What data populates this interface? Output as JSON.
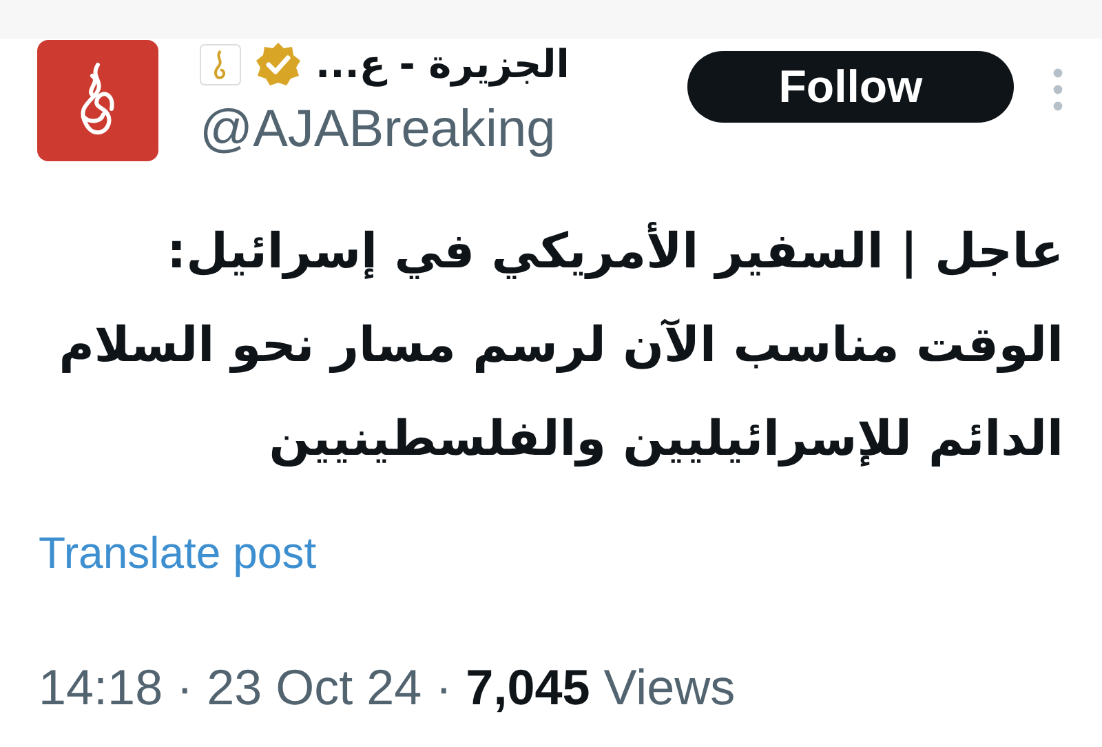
{
  "author": {
    "name": "الجزيرة - ع...",
    "verified": true,
    "handle": "@AJABreaking"
  },
  "follow_button": "Follow",
  "post": {
    "text": "عاجل | السفير الأمريكي في إسرائيل:\nالوقت مناسب الآن لرسم مسار نحو السلام\nالدائم للإسرائيليين والفلسطينيين"
  },
  "translate_link": "Translate post",
  "meta": "14:18 · 23 Oct 24 · **7,045** Views"
}
